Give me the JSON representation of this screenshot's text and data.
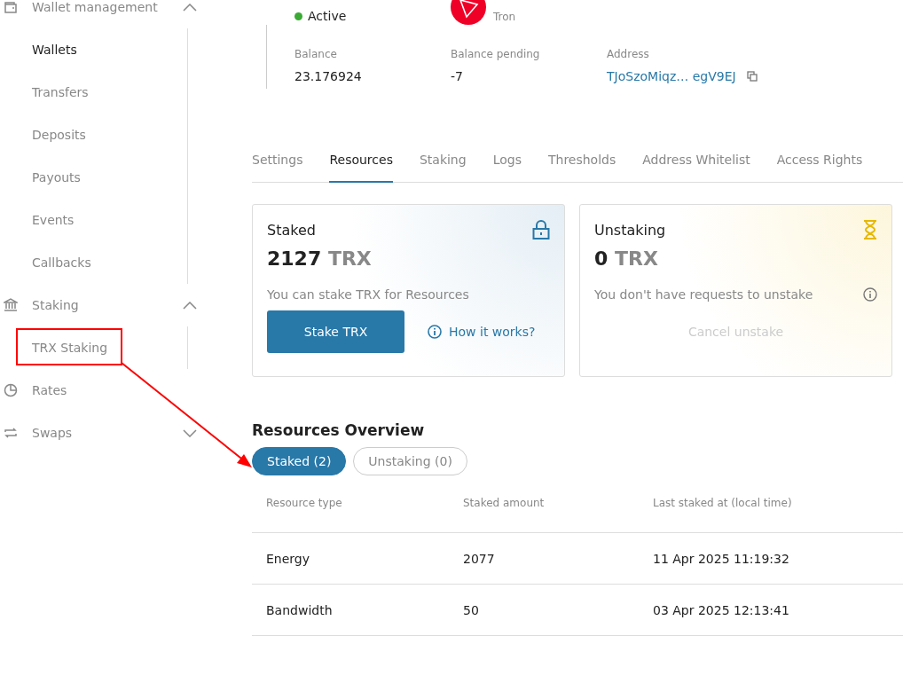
{
  "sidebar": {
    "groups": [
      {
        "label": "Wallet management",
        "kind": "wallet",
        "expanded": true,
        "children": [
          {
            "label": "Wallets",
            "selected": true
          },
          {
            "label": "Transfers",
            "selected": false
          },
          {
            "label": "Deposits",
            "selected": false
          },
          {
            "label": "Payouts",
            "selected": false
          },
          {
            "label": "Events",
            "selected": false
          },
          {
            "label": "Callbacks",
            "selected": false
          }
        ]
      },
      {
        "label": "Staking",
        "kind": "bank",
        "expanded": true,
        "children": [
          {
            "label": "TRX Staking",
            "selected": false
          }
        ]
      },
      {
        "label": "Rates",
        "kind": "pie"
      },
      {
        "label": "Swaps",
        "kind": "swap",
        "expanded": false
      }
    ]
  },
  "wallet": {
    "status": {
      "label": "Active",
      "color": "#3aaa35"
    },
    "network": "Tron",
    "stats": [
      {
        "label": "Balance",
        "value": "23.176924",
        "kind": "plain"
      },
      {
        "label": "Balance pending",
        "value": "-7",
        "kind": "plain"
      },
      {
        "label": "Address",
        "value": "TJoSzoMiqz… egV9EJ",
        "kind": "address"
      }
    ]
  },
  "tabs": [
    {
      "label": "Settings",
      "selected": false
    },
    {
      "label": "Resources",
      "selected": true
    },
    {
      "label": "Staking",
      "selected": false
    },
    {
      "label": "Logs",
      "selected": false
    },
    {
      "label": "Thresholds",
      "selected": false
    },
    {
      "label": "Address Whitelist",
      "selected": false
    },
    {
      "label": "Access Rights",
      "selected": false
    }
  ],
  "cards": [
    {
      "kind": "staked",
      "title": "Staked",
      "amount": "2127",
      "unit": "TRX",
      "note": "You can stake TRX for Resources",
      "button": "Stake TRX",
      "link": "How it works?"
    },
    {
      "kind": "unstaking",
      "title": "Unstaking",
      "amount": "0",
      "unit": "TRX",
      "note": "You don't have requests to unstake",
      "button": "Cancel unstake",
      "disabled": true
    }
  ],
  "overview": {
    "title": "Resources Overview",
    "filters": [
      {
        "label": "Staked (2)",
        "selected": true
      },
      {
        "label": "Unstaking (0)",
        "selected": false
      }
    ],
    "table": {
      "columns": [
        "Resource type",
        "Staked amount",
        "Last staked at (local time)"
      ],
      "rows": [
        [
          "Energy",
          "2077",
          "11 Apr 2025 11:19:32"
        ],
        [
          "Bandwidth",
          "50",
          "03 Apr 2025 12:13:41"
        ]
      ]
    }
  }
}
